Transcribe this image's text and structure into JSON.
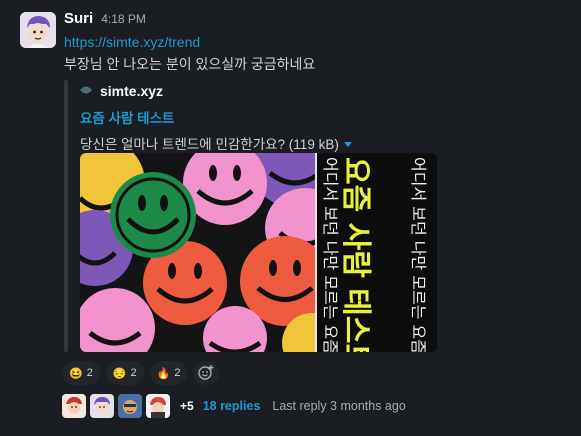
{
  "message": {
    "sender": "Suri",
    "time": "4:18 PM",
    "link": "https://simte.xyz/trend",
    "text": "부장님 안 나오는 분이 있으실까 궁금하네요"
  },
  "unfurl": {
    "site_icon": "site-favicon-icon",
    "site_name": "simte.xyz",
    "title": "요즘 사람 테스트",
    "description": "당신은 얼마나 트렌드에 민감한가요? (119 kB)",
    "expand_icon": "caret-down-icon",
    "image": {
      "title_text": "요즘 사람 테스트",
      "side_text_1": "어디서 보던 나만 모르는 요즘것",
      "side_text_2": "어디서 보던 나만 모르는 요즘것"
    }
  },
  "reactions": [
    {
      "emoji": "😆",
      "count": "2"
    },
    {
      "emoji": "😔",
      "count": "2"
    },
    {
      "emoji": "🔥",
      "count": "2"
    }
  ],
  "thread": {
    "more": "+5",
    "replies": "18 replies",
    "last_reply": "Last reply 3 months ago"
  },
  "colors": {
    "background": "#1a1d21",
    "link": "#1d9bd1",
    "accent_yellow": "#e9f23b"
  }
}
